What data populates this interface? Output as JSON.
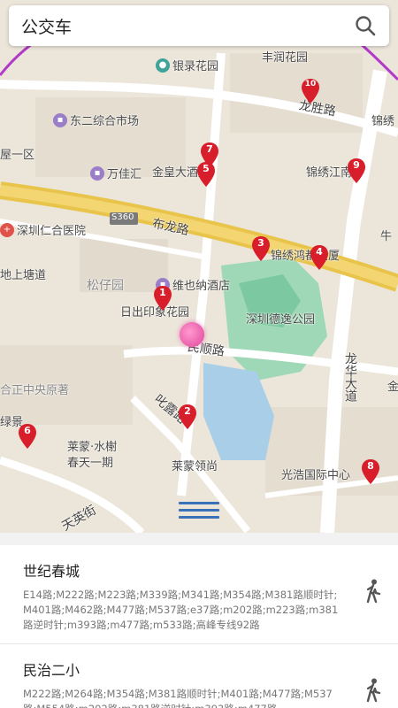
{
  "header": {
    "title": "公交车",
    "search_icon": "search-icon"
  },
  "map": {
    "roads": {
      "bulong": "布龙路",
      "s360": "S360",
      "minshun": "民顺路",
      "longsheng": "龙胜路",
      "longhua": "龙华大道",
      "pilu": "叱露路",
      "tianying": "天英街"
    },
    "pois": {
      "yinlu": "银录花园",
      "fengrun": "丰润花园",
      "dongershop": "东二综合市场",
      "jinxiu": "锦绣",
      "wuyi": "屋一区",
      "jinhuang": "金皇大酒店",
      "wanjia": "万佳汇",
      "jinxiujiang": "锦绣江南",
      "renhe": "深圳仁合医院",
      "jinxiuhong": "锦绣鸿都大厦",
      "niu": "牛",
      "shangtang": "地上塘道",
      "songzai": "松仔园",
      "weiye": "维也纳酒店",
      "richu": "日出印象花园",
      "deyi": "深圳德逸公园",
      "hezheng": "合正中央原著",
      "lvjing": "绿景",
      "laimeng_shuixie": "莱蒙·水榭",
      "chuntian": "春天一期",
      "laimeng_lingshang": "莱蒙领尚",
      "guanghao": "光浩国际中心",
      "jin": "金"
    },
    "markers": [
      "1",
      "2",
      "3",
      "4",
      "5",
      "6",
      "7",
      "8",
      "9",
      "10"
    ]
  },
  "stops": [
    {
      "name": "世纪春城",
      "routes": "E14路;M222路;M223路;M339路;M341路;M354路;M381路顺时针;M401路;M462路;M477路;M537路;e37路;m202路;m223路;m381路逆时针;m393路;m477路;m533路;高峰专线92路"
    },
    {
      "name": "民治二小",
      "routes": "M222路;M264路;M354路;M381路顺时针;M401路;M477路;M537路;M554路;m202路;m381路逆时针;m393路;m477路"
    }
  ],
  "colors": {
    "accent": "#3a72b8",
    "marker": "#d81e2a",
    "bulong_road": "#e8c44a",
    "park": "#7cc8a0"
  }
}
